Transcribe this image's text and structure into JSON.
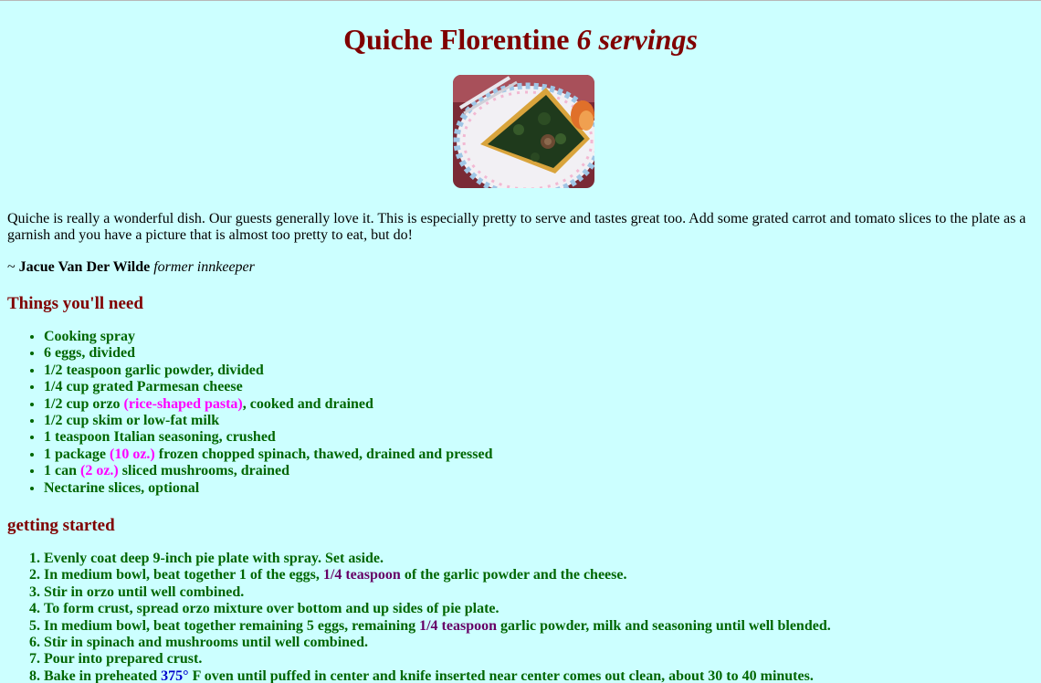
{
  "title": {
    "main": "Quiche Florentine",
    "servings": "6 servings"
  },
  "intro": "Quiche is really a wonderful dish. Our guests generally love it. This is especially pretty to serve and tastes great too. Add some grated carrot and tomato slices to the plate as a garnish and you have a picture that is almost too pretty to eat, but do!",
  "byline": {
    "prefix": "~ ",
    "name": "Jacue Van Der Wilde",
    "role": "former innkeeper"
  },
  "sections": {
    "ingredients": "Things you'll need",
    "steps": "getting started"
  },
  "ingredients": [
    {
      "pre": "Cooking spray"
    },
    {
      "pre": "6 eggs, divided"
    },
    {
      "pre": "1/2 teaspoon garlic powder, divided"
    },
    {
      "pre": "1/4 cup grated Parmesan cheese"
    },
    {
      "pre": "1/2 cup orzo ",
      "qty": "(rice-shaped pasta)",
      "post": ", cooked and drained"
    },
    {
      "pre": "1/2 cup skim or low-fat milk"
    },
    {
      "pre": "1 teaspoon Italian seasoning, crushed"
    },
    {
      "pre": "1 package ",
      "qty": "(10 oz.)",
      "post": " frozen chopped spinach, thawed, drained and pressed"
    },
    {
      "pre": "1 can ",
      "qty": "(2 oz.)",
      "post": " sliced mushrooms, drained"
    },
    {
      "pre": "Nectarine slices, optional"
    }
  ],
  "steps": [
    {
      "pre": "Evenly coat deep 9-inch pie plate with spray. Set aside."
    },
    {
      "pre": "In medium bowl, beat together 1 of the eggs, ",
      "measure": "1/4 teaspoon",
      "post": " of the garlic powder and the cheese."
    },
    {
      "pre": "Stir in orzo until well combined."
    },
    {
      "pre": "To form crust, spread orzo mixture over bottom and up sides of pie plate."
    },
    {
      "pre": "In medium bowl, beat together remaining 5 eggs, remaining ",
      "measure": "1/4 teaspoon",
      "post": " garlic powder, milk and seasoning until well blended."
    },
    {
      "pre": "Stir in spinach and mushrooms until well combined."
    },
    {
      "pre": "Pour into prepared crust."
    },
    {
      "pre": "Bake in preheated ",
      "temp": "375°",
      "post": " F oven until puffed in center and knife inserted near center comes out clean, about 30 to 40 minutes."
    }
  ],
  "colors": {
    "background": "#ccffff",
    "heading": "#800000",
    "list_text": "#006600",
    "quantity": "#ff00ff",
    "measure": "#660066",
    "temperature": "#0000cc"
  }
}
